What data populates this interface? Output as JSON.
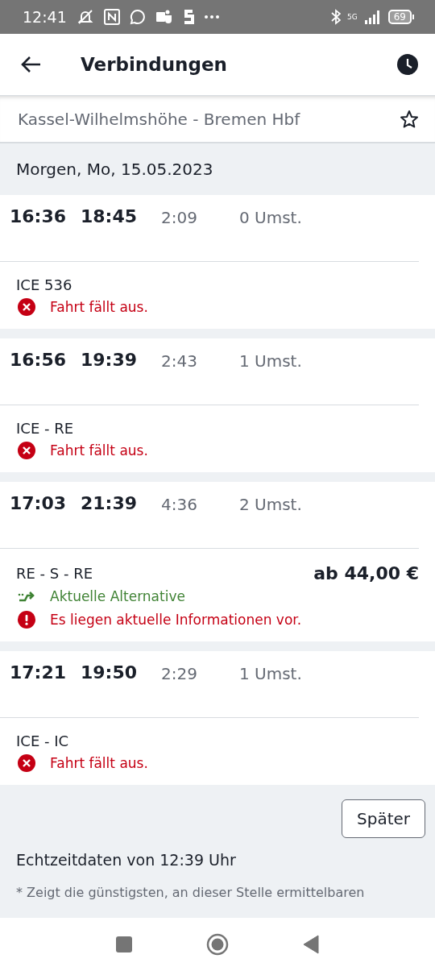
{
  "status_bar": {
    "time": "12:41",
    "network": "5G",
    "battery": "69"
  },
  "header": {
    "title": "Verbindungen"
  },
  "route": {
    "text": "Kassel-Wilhelmshöhe - Bremen Hbf",
    "favorite": false
  },
  "date": "Morgen, Mo, 15.05.2023",
  "connections": [
    {
      "departure": "16:36",
      "arrival": "18:45",
      "duration": "2:09",
      "changes": "0 Umst.",
      "trains": "ICE 536",
      "messages": [
        {
          "kind": "cancelled",
          "text": "Fahrt fällt aus."
        }
      ]
    },
    {
      "departure": "16:56",
      "arrival": "19:39",
      "duration": "2:43",
      "changes": "1 Umst.",
      "trains": "ICE - RE",
      "messages": [
        {
          "kind": "cancelled",
          "text": "Fahrt fällt aus."
        }
      ]
    },
    {
      "departure": "17:03",
      "arrival": "21:39",
      "duration": "4:36",
      "changes": "2 Umst.",
      "trains": "RE - S - RE",
      "price": "ab 44,00 €",
      "messages": [
        {
          "kind": "alternative",
          "text": "Aktuelle Alternative"
        },
        {
          "kind": "info",
          "text": "Es liegen aktuelle Informationen vor."
        }
      ]
    },
    {
      "departure": "17:21",
      "arrival": "19:50",
      "duration": "2:29",
      "changes": "1 Umst.",
      "trains": "ICE - IC",
      "messages": [
        {
          "kind": "cancelled",
          "text": "Fahrt fällt aus."
        }
      ]
    }
  ],
  "later_button": "Später",
  "realtime_note": "Echtzeitdaten von 12:39 Uhr",
  "footnote": "* Zeigt die günstigsten, an dieser Stelle ermittelbaren"
}
